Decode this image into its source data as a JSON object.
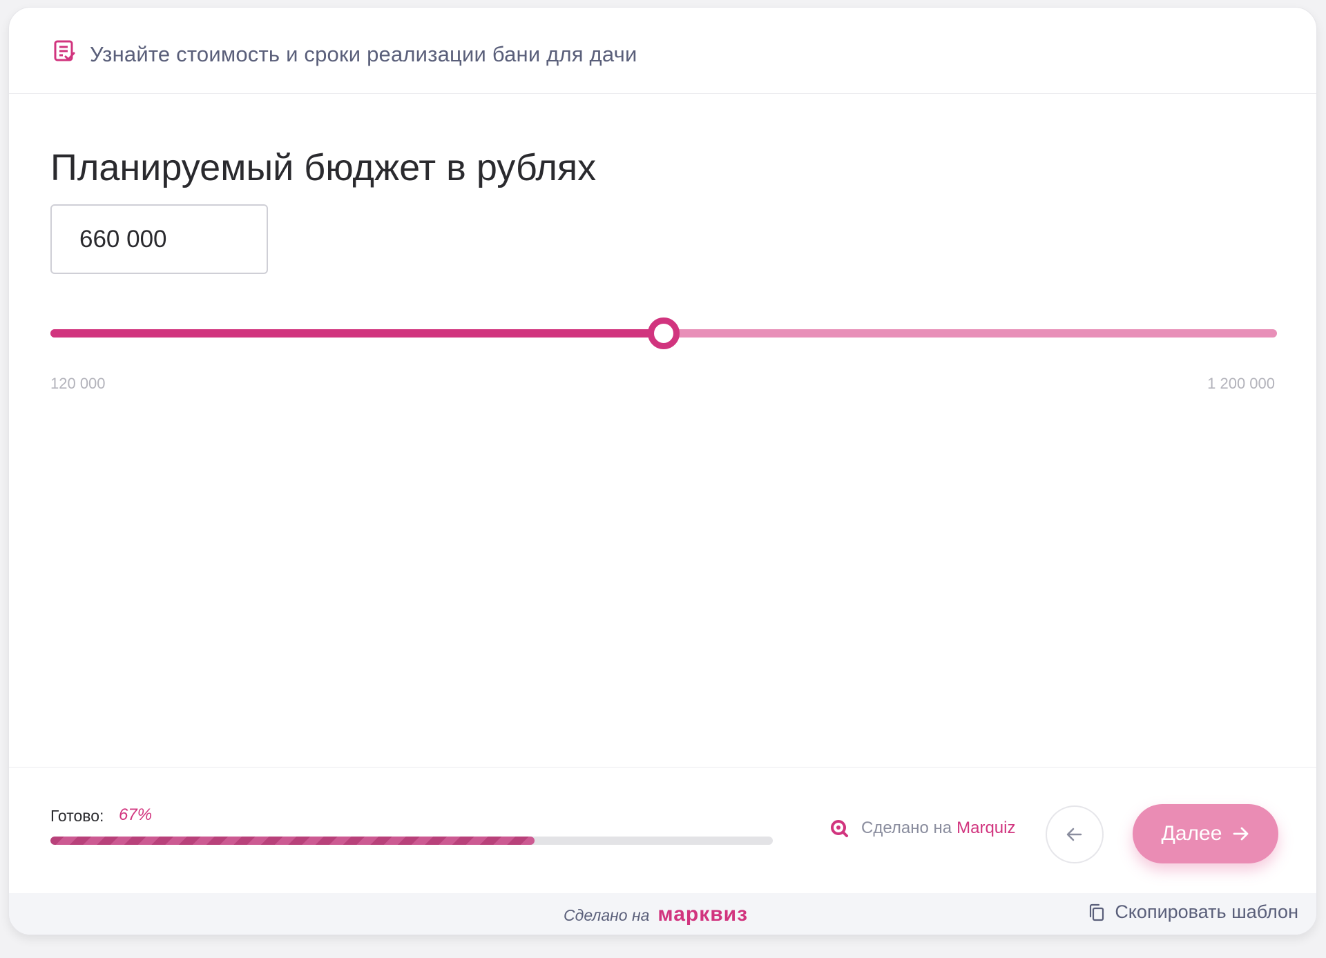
{
  "header": {
    "title": "Узнайте стоимость и сроки реализации бани для дачи",
    "icon": "document-check-icon"
  },
  "question": {
    "title": "Планируемый бюджет в рублях"
  },
  "budget": {
    "value": "660 000",
    "min_label": "120 000",
    "max_label": "1 200 000",
    "min": 120000,
    "max": 1200000,
    "current": 660000
  },
  "footer": {
    "progress_label": "Готово:",
    "progress_value": "67%",
    "progress": 0.67,
    "made_on_text": "Сделано на",
    "made_on_brand": "Marquiz",
    "next_label": "Далее",
    "back_icon": "arrow-left-icon",
    "next_icon": "arrow-right-icon"
  },
  "bottom_strip": {
    "made_text": "Сделано на",
    "logo_text": "марквиз",
    "copy_label": "Скопировать шаблон",
    "copy_icon": "copy-icon"
  },
  "colors": {
    "accent": "#d1347e",
    "accent_light": "#e88fb8",
    "button": "#ea8cb4",
    "text": "#2a2a2e",
    "muted": "#5a5f7a"
  }
}
